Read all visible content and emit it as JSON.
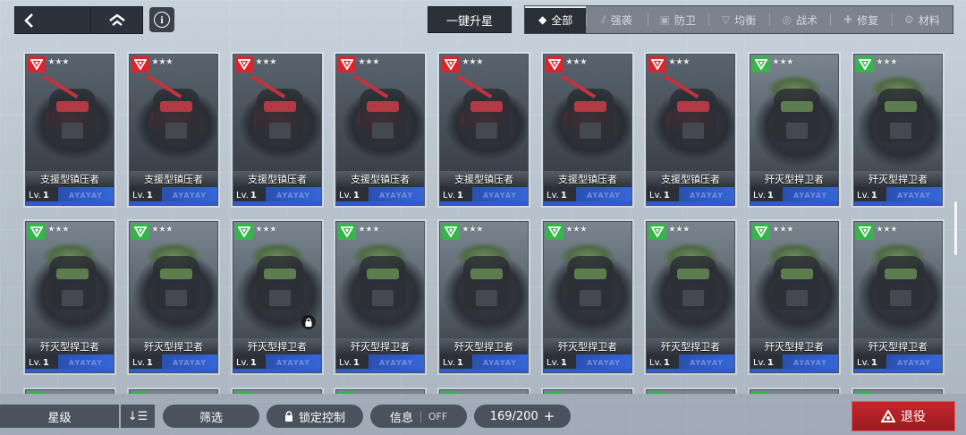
{
  "nav": {
    "back_icon": "chevron-left-icon",
    "home_icon": "home-icon",
    "info_label": "i"
  },
  "toolbar": {
    "upgrade_all_label": "一键升星"
  },
  "tabs": [
    {
      "label": "全部",
      "icon": "◆",
      "active": true
    },
    {
      "label": "强袭",
      "icon": "⫽",
      "active": false
    },
    {
      "label": "防卫",
      "icon": "▣",
      "active": false
    },
    {
      "label": "均衡",
      "icon": "▽",
      "active": false
    },
    {
      "label": "战术",
      "icon": "◎",
      "active": false
    },
    {
      "label": "修复",
      "icon": "✚",
      "active": false
    },
    {
      "label": "材料",
      "icon": "⚙",
      "active": false
    }
  ],
  "cards": [
    {
      "name": "支援型镇压者",
      "type": "red",
      "stars": "★★★",
      "lv_label": "Lv.",
      "level": "1",
      "locked": false
    },
    {
      "name": "支援型镇压者",
      "type": "red",
      "stars": "★★★",
      "lv_label": "Lv.",
      "level": "1",
      "locked": false
    },
    {
      "name": "支援型镇压者",
      "type": "red",
      "stars": "★★★",
      "lv_label": "Lv.",
      "level": "1",
      "locked": false
    },
    {
      "name": "支援型镇压者",
      "type": "red",
      "stars": "★★★",
      "lv_label": "Lv.",
      "level": "1",
      "locked": false
    },
    {
      "name": "支援型镇压者",
      "type": "red",
      "stars": "★★★",
      "lv_label": "Lv.",
      "level": "1",
      "locked": false
    },
    {
      "name": "支援型镇压者",
      "type": "red",
      "stars": "★★★",
      "lv_label": "Lv.",
      "level": "1",
      "locked": false
    },
    {
      "name": "支援型镇压者",
      "type": "red",
      "stars": "★★★",
      "lv_label": "Lv.",
      "level": "1",
      "locked": false
    },
    {
      "name": "歼灭型捍卫者",
      "type": "green",
      "stars": "★★★",
      "lv_label": "Lv.",
      "level": "1",
      "locked": false
    },
    {
      "name": "歼灭型捍卫者",
      "type": "green",
      "stars": "★★★",
      "lv_label": "Lv.",
      "level": "1",
      "locked": false
    },
    {
      "name": "歼灭型捍卫者",
      "type": "green",
      "stars": "★★★",
      "lv_label": "Lv.",
      "level": "1",
      "locked": false
    },
    {
      "name": "歼灭型捍卫者",
      "type": "green",
      "stars": "★★★",
      "lv_label": "Lv.",
      "level": "1",
      "locked": false
    },
    {
      "name": "歼灭型捍卫者",
      "type": "green",
      "stars": "★★★",
      "lv_label": "Lv.",
      "level": "1",
      "locked": true
    },
    {
      "name": "歼灭型捍卫者",
      "type": "green",
      "stars": "★★★",
      "lv_label": "Lv.",
      "level": "1",
      "locked": false
    },
    {
      "name": "歼灭型捍卫者",
      "type": "green",
      "stars": "★★★",
      "lv_label": "Lv.",
      "level": "1",
      "locked": false
    },
    {
      "name": "歼灭型捍卫者",
      "type": "green",
      "stars": "★★★",
      "lv_label": "Lv.",
      "level": "1",
      "locked": false
    },
    {
      "name": "歼灭型捍卫者",
      "type": "green",
      "stars": "★★★",
      "lv_label": "Lv.",
      "level": "1",
      "locked": false
    },
    {
      "name": "歼灭型捍卫者",
      "type": "green",
      "stars": "★★★",
      "lv_label": "Lv.",
      "level": "1",
      "locked": false
    },
    {
      "name": "歼灭型捍卫者",
      "type": "green",
      "stars": "★★★",
      "lv_label": "Lv.",
      "level": "1",
      "locked": false
    }
  ],
  "card_deco": "AYAYAY",
  "bottom": {
    "star_sort_label": "星级",
    "sort_order_icon": "↓☰",
    "filter_label": "筛选",
    "lock_control_label": "锁定控制",
    "info_label": "信息",
    "info_toggle": "OFF",
    "count": "169/200",
    "expand_icon": "+",
    "retire_label": "退役"
  },
  "colors": {
    "red_badge": "#d8262f",
    "green_badge": "#36b54a",
    "retire": "#b52228"
  }
}
